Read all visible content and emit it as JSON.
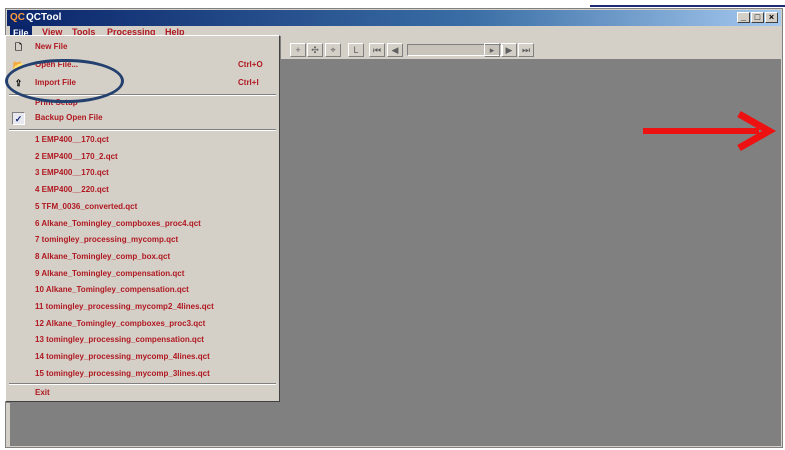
{
  "window": {
    "title": "QCTool",
    "app_icon": "qc-app-icon",
    "controls": [
      "_",
      "□",
      "×"
    ]
  },
  "menubar": {
    "items": [
      "File",
      "View",
      "Tools",
      "Processing",
      "Help"
    ],
    "active": "File"
  },
  "file_menu": {
    "items": [
      {
        "label": "New File",
        "shortcut": "",
        "icon": "new-file-icon"
      },
      {
        "label": "Open File...",
        "shortcut": "Ctrl+O",
        "icon": "open-folder-icon"
      },
      {
        "label": "Import File",
        "shortcut": "Ctrl+I",
        "icon": "import-file-icon"
      },
      {
        "label": "Print Setup",
        "shortcut": "",
        "icon": ""
      },
      {
        "label": "Backup Open File",
        "shortcut": "",
        "icon": "checkmark-icon",
        "checked": true
      }
    ],
    "recent_files": [
      "1 EMP400__170.qct",
      "2 EMP400__170_2.qct",
      "3 EMP400__170.qct",
      "4 EMP400__220.qct",
      "5 TFM_0036_converted.qct",
      "6 Alkane_Tomingley_compboxes_proc4.qct",
      "7 tomingley_processing_mycomp.qct",
      "8 Alkane_Tomingley_comp_box.qct",
      "9 Alkane_Tomingley_compensation.qct",
      "10 Alkane_Tomingley_compensation.qct",
      "11 tomingley_processing_mycomp2_4lines.qct",
      "12 Alkane_Tomingley_compboxes_proc3.qct",
      "13 tomingley_processing_compensation.qct",
      "14 tomingley_processing_mycomp_4lines.qct",
      "15 tomingley_processing_mycomp_3lines.qct"
    ],
    "exit_label": "Exit"
  },
  "annotations": {
    "highlight_circle_color": "#24406e",
    "arrow_color": "#ee1111"
  }
}
